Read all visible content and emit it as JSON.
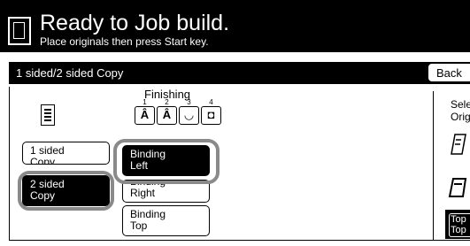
{
  "header": {
    "title": "Ready to Job build.",
    "subtitle": "Place originals then press Start key."
  },
  "tabbar": {
    "label": "1 sided/2 sided Copy",
    "back_label": "Back"
  },
  "finishing": {
    "label": "Finishing",
    "options": [
      {
        "number": "1",
        "glyph": "Â"
      },
      {
        "number": "2",
        "glyph": "Â"
      },
      {
        "number": "3",
        "glyph": "◡"
      },
      {
        "number": "4",
        "glyph": "◘"
      }
    ]
  },
  "copy_modes": [
    {
      "line1": "1 sided",
      "line2": "Copy",
      "selected": false
    },
    {
      "line1": "2 sided",
      "line2": "Copy",
      "selected": true
    }
  ],
  "binding_options": [
    {
      "line1": "Binding",
      "line2": "Left",
      "selected": true
    },
    {
      "line1": "Binding",
      "line2": "Right",
      "selected": false
    },
    {
      "line1": "Binding",
      "line2": "Top",
      "selected": false
    }
  ],
  "right_panel": {
    "text_line1": "Select",
    "text_line2": "Orig",
    "button_line1": "Top",
    "button_line2": "Top"
  }
}
